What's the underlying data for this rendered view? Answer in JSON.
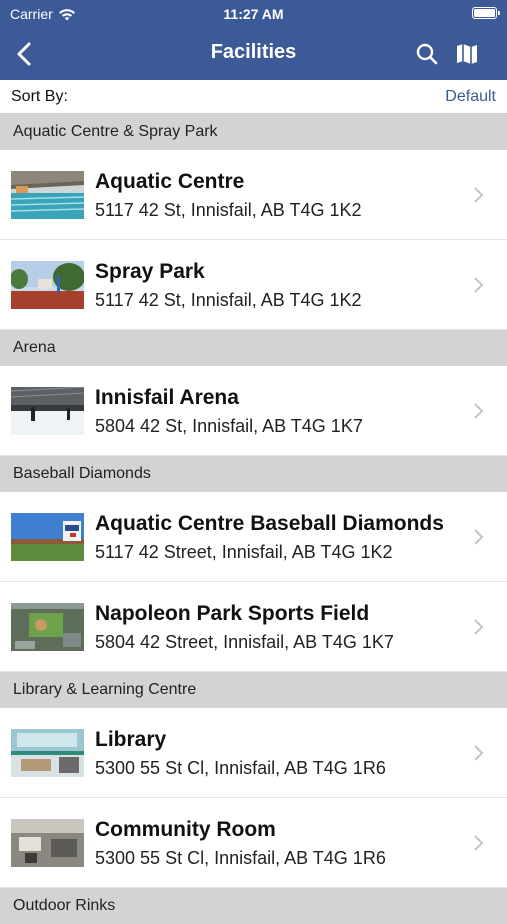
{
  "status_bar": {
    "carrier": "Carrier",
    "time": "11:27 AM"
  },
  "nav": {
    "title": "Facilities",
    "back_icon": "chevron-left-icon",
    "search_icon": "search-icon",
    "map_icon": "map-icon"
  },
  "sort": {
    "label": "Sort By:",
    "value": "Default"
  },
  "sections": [
    {
      "header": "Aquatic Centre & Spray Park",
      "items": [
        {
          "name": "Aquatic Centre",
          "address": "5117 42 St, Innisfail, AB T4G 1K2",
          "thumb": "pool"
        },
        {
          "name": "Spray Park",
          "address": "5117 42 St, Innisfail, AB T4G 1K2",
          "thumb": "spraypark"
        }
      ]
    },
    {
      "header": "Arena",
      "items": [
        {
          "name": "Innisfail Arena",
          "address": "5804 42 St, Innisfail, AB T4G 1K7",
          "thumb": "arena"
        }
      ]
    },
    {
      "header": "Baseball Diamonds",
      "items": [
        {
          "name": "Aquatic Centre Baseball Diamonds",
          "address": "5117 42 Street, Innisfail, AB T4G 1K2",
          "thumb": "baseball"
        },
        {
          "name": "Napoleon Park Sports Field",
          "address": "5804 42 Street, Innisfail, AB T4G 1K7",
          "thumb": "aerial"
        }
      ]
    },
    {
      "header": "Library & Learning Centre",
      "items": [
        {
          "name": "Library",
          "address": "5300 55 St Cl, Innisfail, AB T4G 1R6",
          "thumb": "library"
        },
        {
          "name": "Community Room",
          "address": "5300 55 St Cl, Innisfail, AB T4G 1R6",
          "thumb": "room"
        }
      ]
    },
    {
      "header": "Outdoor Rinks",
      "items": []
    }
  ],
  "colors": {
    "brand": "#3d5a98",
    "section_bg": "#d3d3d3",
    "chevron": "#c4c4c6"
  }
}
